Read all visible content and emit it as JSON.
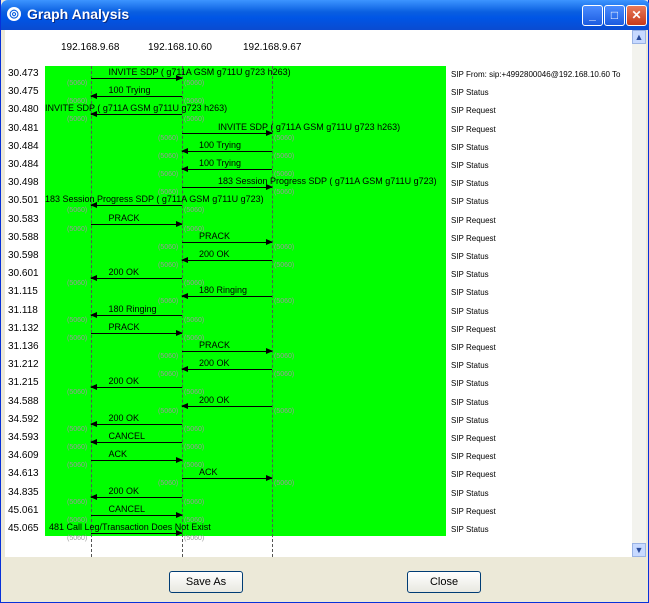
{
  "window": {
    "title": "Graph Analysis"
  },
  "hosts": [
    "192.168.9.68",
    "192.168.10.60",
    "192.168.9.67"
  ],
  "rows": [
    {
      "time": "30.473",
      "label": "INVITE SDP ( g711A GSM g711U g723 h263)",
      "comment": "SIP From: sip:+4992800046@192.168.10.60 To"
    },
    {
      "time": "30.475",
      "label": "100 Trying",
      "comment": "SIP Status"
    },
    {
      "time": "30.480",
      "label": "INVITE SDP ( g711A GSM g711U g723 h263)",
      "comment": "SIP Request"
    },
    {
      "time": "30.481",
      "label": "INVITE SDP ( g711A GSM g711U g723 h263)",
      "comment": "SIP Request"
    },
    {
      "time": "30.484",
      "label": "100 Trying",
      "comment": "SIP Status"
    },
    {
      "time": "30.484",
      "label": "100 Trying",
      "comment": "SIP Status"
    },
    {
      "time": "30.498",
      "label": "183 Session Progress SDP ( g711A GSM g711U g723)",
      "comment": "SIP Status"
    },
    {
      "time": "30.501",
      "label": "183 Session Progress SDP ( g711A GSM g711U g723)",
      "comment": "SIP Status"
    },
    {
      "time": "30.583",
      "label": "PRACK",
      "comment": "SIP Request"
    },
    {
      "time": "30.588",
      "label": "PRACK",
      "comment": "SIP Request"
    },
    {
      "time": "30.598",
      "label": "200 OK",
      "comment": "SIP Status"
    },
    {
      "time": "30.601",
      "label": "200 OK",
      "comment": "SIP Status"
    },
    {
      "time": "31.115",
      "label": "180 Ringing",
      "comment": "SIP Status"
    },
    {
      "time": "31.118",
      "label": "180 Ringing",
      "comment": "SIP Status"
    },
    {
      "time": "31.132",
      "label": "PRACK",
      "comment": "SIP Request"
    },
    {
      "time": "31.136",
      "label": "PRACK",
      "comment": "SIP Request"
    },
    {
      "time": "31.212",
      "label": "200 OK",
      "comment": "SIP Status"
    },
    {
      "time": "31.215",
      "label": "200 OK",
      "comment": "SIP Status"
    },
    {
      "time": "34.588",
      "label": "200 OK",
      "comment": "SIP Status"
    },
    {
      "time": "34.592",
      "label": "200 OK",
      "comment": "SIP Status"
    },
    {
      "time": "34.593",
      "label": "CANCEL",
      "comment": "SIP Request"
    },
    {
      "time": "34.609",
      "label": "ACK",
      "comment": "SIP Request"
    },
    {
      "time": "34.613",
      "label": "ACK",
      "comment": "SIP Request"
    },
    {
      "time": "34.835",
      "label": "200 OK",
      "comment": "SIP Status"
    },
    {
      "time": "45.061",
      "label": "CANCEL",
      "comment": "SIP Request"
    },
    {
      "time": "45.065",
      "label": "481 Call Leg/Transaction Does Not Exist",
      "comment": "SIP Status"
    }
  ],
  "port_label": "(5060)",
  "buttons": {
    "save_as": "Save As",
    "close": "Close"
  }
}
